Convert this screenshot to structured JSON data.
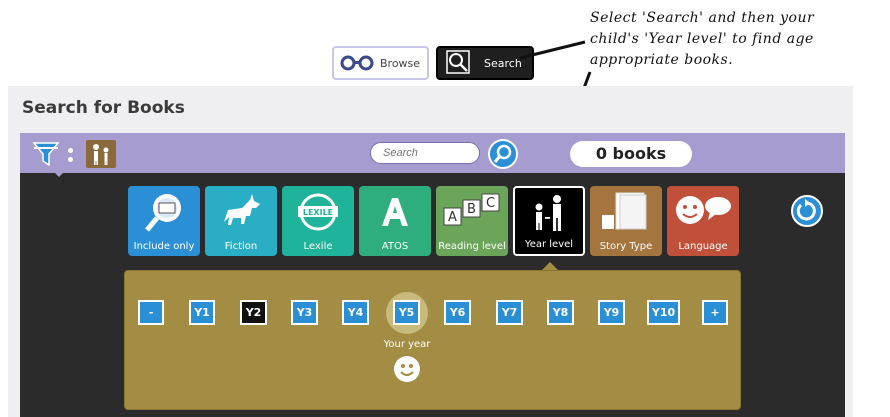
{
  "header": {
    "browse_label": "Browse",
    "search_label": "Search"
  },
  "annotation": {
    "lines": [
      "Select 'Search' and then your",
      "child's 'Year level' to find age",
      "appropriate books."
    ]
  },
  "page": {
    "title": "Search for Books"
  },
  "toolbar": {
    "search_placeholder": "Search",
    "book_count": "0 books"
  },
  "categories": [
    {
      "label": "Include only",
      "color": "#2b8fd6"
    },
    {
      "label": "Fiction",
      "color": "#2aaec6"
    },
    {
      "label": "Lexile",
      "color": "#1fb39a"
    },
    {
      "label": "ATOS",
      "color": "#2eae7c"
    },
    {
      "label": "Reading level",
      "color": "#6aa55a"
    },
    {
      "label": "Year level",
      "color": "#000000",
      "selected": true
    },
    {
      "label": "Story Type",
      "color": "#a5753f"
    },
    {
      "label": "Language",
      "color": "#c0503a"
    }
  ],
  "year_level": {
    "decrement_label": "-",
    "increment_label": "+",
    "years": [
      "Y1",
      "Y2",
      "Y3",
      "Y4",
      "Y5",
      "Y6",
      "Y7",
      "Y8",
      "Y9",
      "Y10"
    ],
    "selected": "Y2",
    "current": "Y5",
    "your_year_label": "Your year"
  },
  "colors": {
    "accent": "#2b8fd6",
    "panel_top": "#a79ccf",
    "panel_dark": "#2b2b2b",
    "year_panel": "#a38d44"
  }
}
